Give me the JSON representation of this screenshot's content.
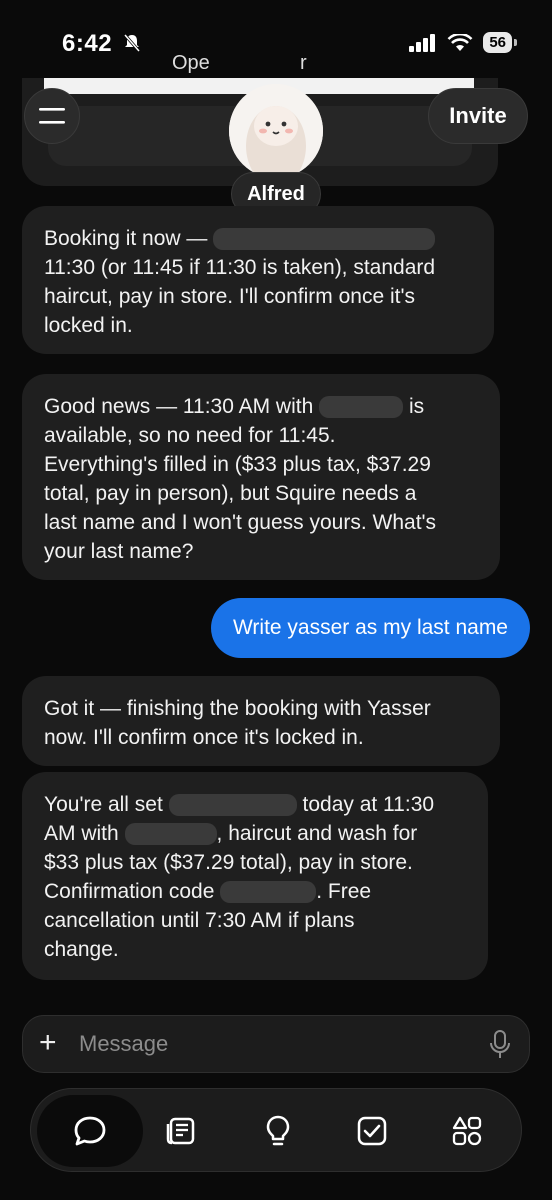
{
  "status": {
    "time": "6:42",
    "battery": "56"
  },
  "preview": {
    "text_left": "Ope",
    "text_right": "r"
  },
  "header": {
    "assistant_name": "Alfred",
    "invite_label": "Invite"
  },
  "messages": [
    {
      "role": "assistant",
      "lines": [
        "Booking it now —",
        "11:30 (or 11:45 if 11:30 is taken), standard",
        "haircut, pay in store. I'll confirm once it's",
        "locked in."
      ]
    },
    {
      "role": "assistant",
      "lines": [
        "Good news — 11:30 AM with",
        "is",
        "available, so no need for 11:45.",
        "Everything's filled in ($33 plus tax, $37.29",
        "total, pay in person), but Squire needs a",
        "last name and I won't guess yours. What's",
        "your last name?"
      ]
    },
    {
      "role": "user",
      "text": "Write yasser as my last name"
    },
    {
      "role": "assistant",
      "lines": [
        "Got it — finishing the booking with Yasser",
        "now. I'll confirm once it's locked in."
      ]
    },
    {
      "role": "assistant",
      "lines": [
        "You're all set",
        "today at 11:30",
        "AM with",
        ", haircut and wash for",
        "$33 plus tax ($37.29 total), pay in store.",
        "Confirmation code",
        ". Free",
        "cancellation until 7:30 AM if plans",
        "change."
      ]
    }
  ],
  "composer": {
    "placeholder": "Message"
  },
  "tabs": [
    "chat-icon",
    "notes-icon",
    "lightbulb-icon",
    "checkbox-icon",
    "apps-icon"
  ],
  "colors": {
    "background": "#0a0a0a",
    "bubble": "#1f1f1f",
    "user_bubble": "#1a73e8"
  }
}
